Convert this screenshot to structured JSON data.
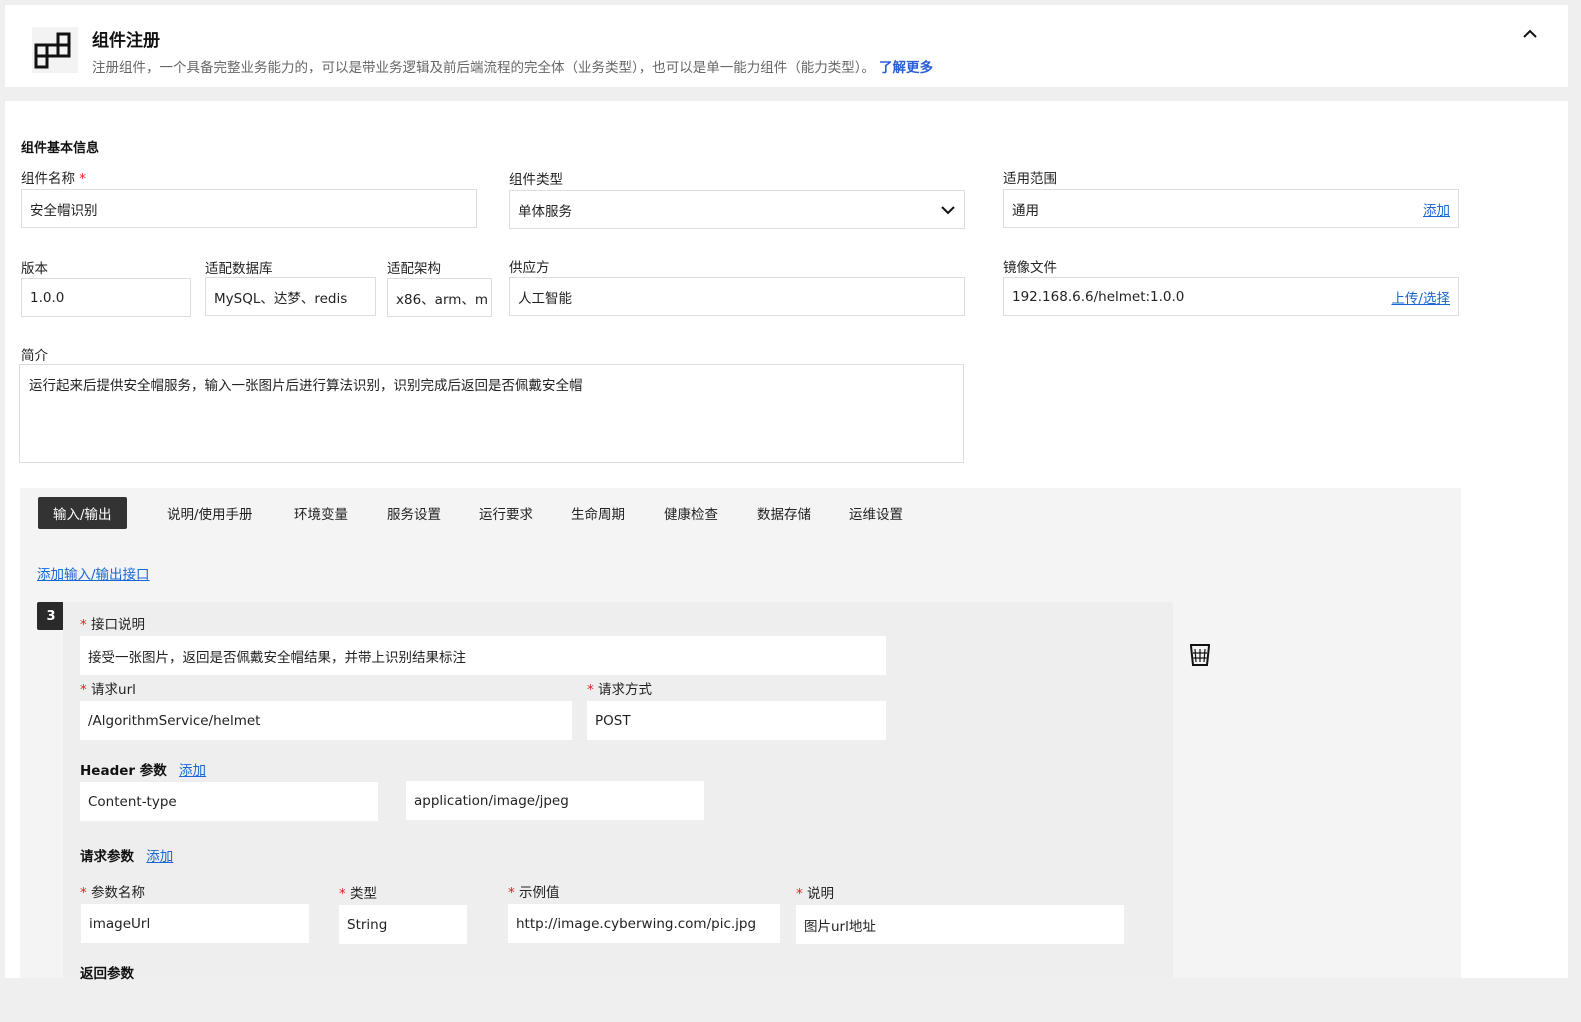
{
  "header": {
    "title": "组件注册",
    "description": "注册组件，一个具备完整业务能力的，可以是带业务逻辑及前后端流程的完全体（业务类型），也可以是单一能力组件（能力类型）。",
    "learn_more": "了解更多"
  },
  "basic": {
    "section_title": "组件基本信息",
    "name_label": "组件名称",
    "required_mark": "*",
    "name_value": "安全帽识别",
    "type_label": "组件类型",
    "type_value": "单体服务",
    "scope_label": "适用范围",
    "scope_value": "通用",
    "scope_add": "添加",
    "version_label": "版本",
    "version_value": "1.0.0",
    "db_label": "适配数据库",
    "db_value": "MySQL、达梦、redis",
    "arch_label": "适配架构",
    "arch_value": "x86、arm、m",
    "vendor_label": "供应方",
    "vendor_value": "人工智能",
    "image_label": "镜像文件",
    "image_value": "192.168.6.6/helmet:1.0.0",
    "image_upload": "上传/选择",
    "intro_label": "简介",
    "intro_value": "运行起来后提供安全帽服务，输入一张图片后进行算法识别，识别完成后返回是否佩戴安全帽"
  },
  "tabs": [
    {
      "label": "输入/输出"
    },
    {
      "label": "说明/使用手册"
    },
    {
      "label": "环境变量"
    },
    {
      "label": "服务设置"
    },
    {
      "label": "运行要求"
    },
    {
      "label": "生命周期"
    },
    {
      "label": "健康检查"
    },
    {
      "label": "数据存储"
    },
    {
      "label": "运维设置"
    }
  ],
  "io": {
    "add_interface": "添加输入/输出接口",
    "index": "3",
    "required_mark": "*",
    "desc_label": "接口说明",
    "desc_value": "接受一张图片，返回是否佩戴安全帽结果，并带上识别结果标注",
    "url_label": "请求url",
    "url_value": "/AlgorithmService/helmet",
    "method_label": "请求方式",
    "method_value": "POST",
    "header_label": "Header 参数",
    "header_add": "添加",
    "header_key": "Content-type",
    "header_value": "application/image/jpeg",
    "req_params_label": "请求参数",
    "req_params_add": "添加",
    "param_name_label": "参数名称",
    "param_type_label": "类型",
    "param_example_label": "示例值",
    "param_desc_label": "说明",
    "param_name_value": "imageUrl",
    "param_type_value": "String",
    "param_example_value": "http://image.cyberwing.com/pic.jpg",
    "param_desc_value": "图片url地址",
    "return_params_label": "返回参数"
  }
}
